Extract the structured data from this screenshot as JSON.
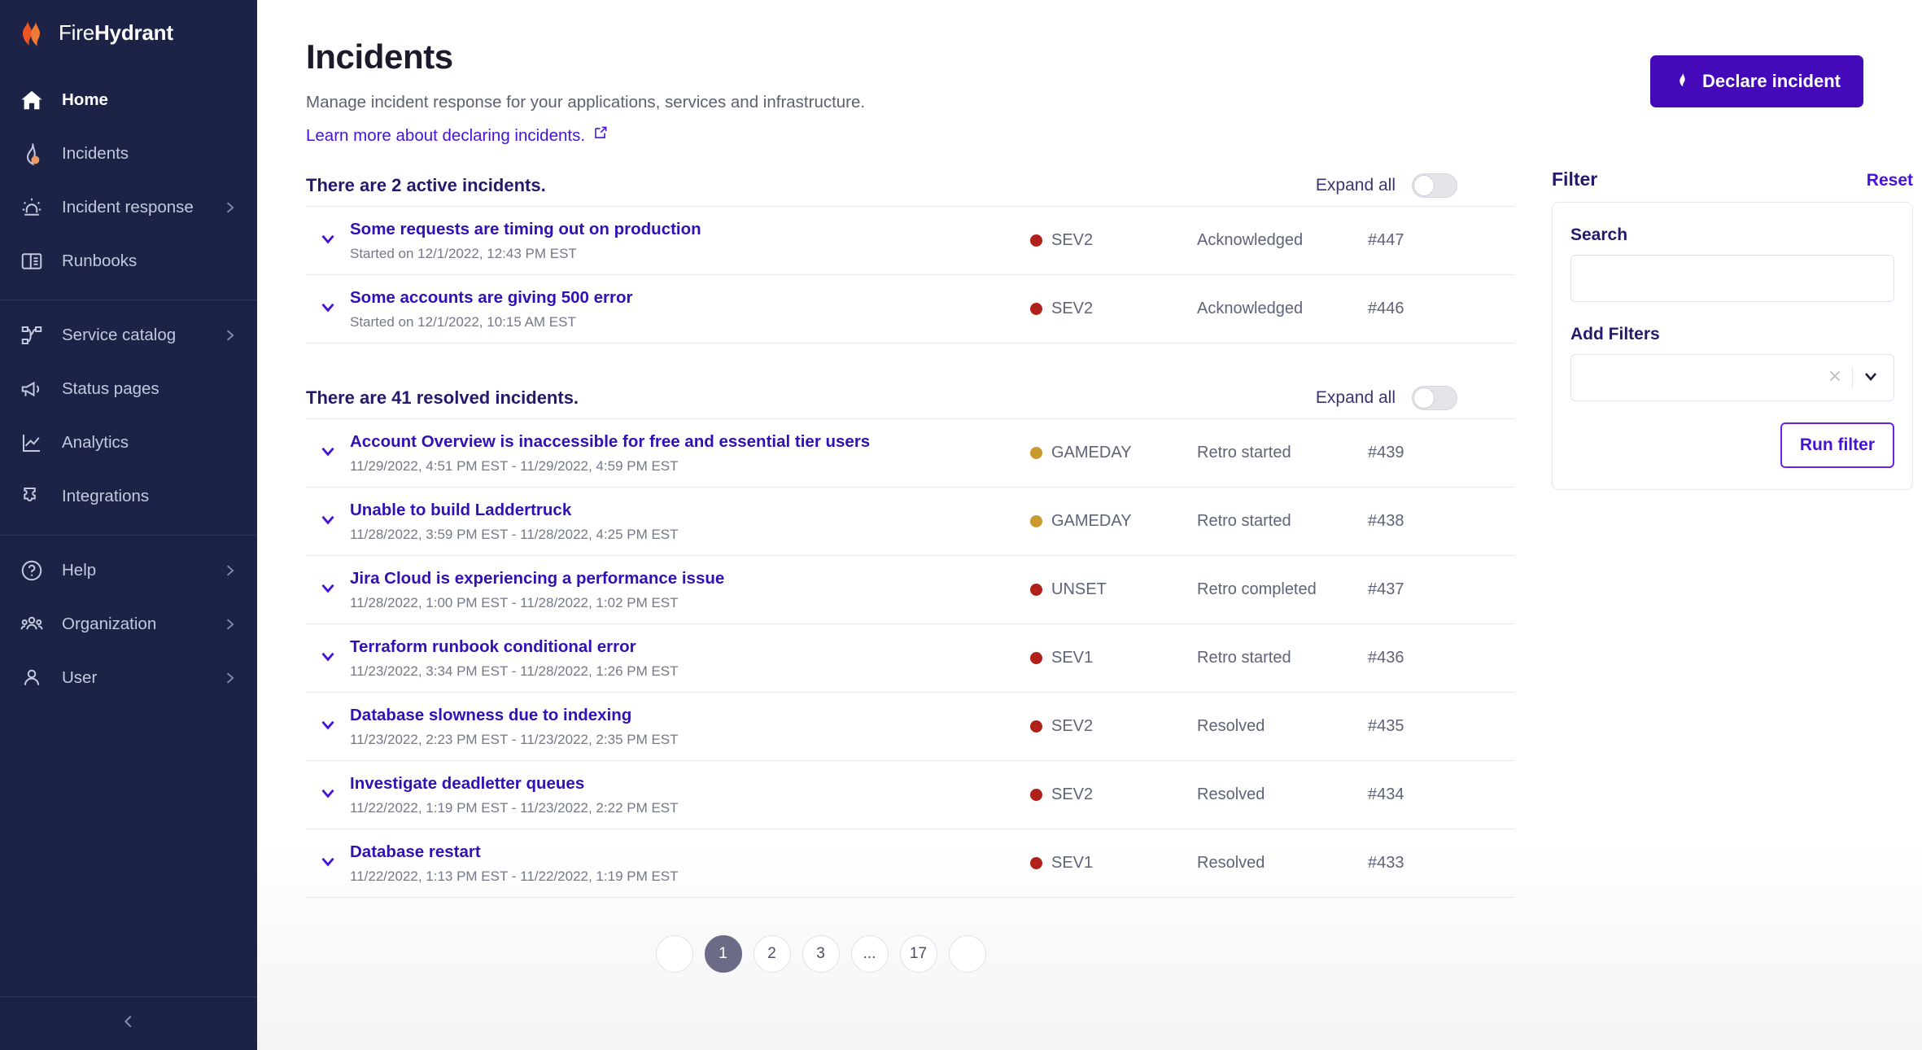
{
  "brand": {
    "name_light": "Fire",
    "name_bold": "Hydrant",
    "logo_icon": "firehydrant-flame-logo"
  },
  "sidebar": {
    "groups": [
      {
        "items": [
          {
            "label": "Home",
            "icon": "home-icon",
            "active": true,
            "caret": false
          },
          {
            "label": "Incidents",
            "icon": "flame-incidents-icon",
            "active": false,
            "caret": false
          },
          {
            "label": "Incident response",
            "icon": "siren-icon",
            "active": false,
            "caret": true
          },
          {
            "label": "Runbooks",
            "icon": "book-icon",
            "active": false,
            "caret": false
          }
        ]
      },
      {
        "items": [
          {
            "label": "Service catalog",
            "icon": "service-catalog-icon",
            "active": false,
            "caret": true
          },
          {
            "label": "Status pages",
            "icon": "megaphone-icon",
            "active": false,
            "caret": false
          },
          {
            "label": "Analytics",
            "icon": "chart-line-icon",
            "active": false,
            "caret": false
          },
          {
            "label": "Integrations",
            "icon": "puzzle-piece-icon",
            "active": false,
            "caret": false
          }
        ]
      },
      {
        "items": [
          {
            "label": "Help",
            "icon": "question-circle-icon",
            "active": false,
            "caret": true
          },
          {
            "label": "Organization",
            "icon": "people-group-icon",
            "active": false,
            "caret": true
          },
          {
            "label": "User",
            "icon": "user-icon",
            "active": false,
            "caret": true
          }
        ]
      }
    ],
    "collapse_icon": "chevron-left-icon"
  },
  "header": {
    "title": "Incidents",
    "subtitle": "Manage incident response for your applications, services and infrastructure.",
    "link_text": "Learn more about declaring incidents.",
    "link_icon": "external-link-icon",
    "declare_label": "Declare incident",
    "declare_icon": "flame-icon"
  },
  "active_section": {
    "title": "There are 2 active incidents.",
    "expand_label": "Expand all",
    "toggle_on": false,
    "rows": [
      {
        "title": "Some requests are timing out on production",
        "time": "Started on 12/1/2022, 12:43 PM EST",
        "severity": "SEV2",
        "sev_color": "#b0211a",
        "status": "Acknowledged",
        "number": "#447"
      },
      {
        "title": "Some accounts are giving 500 error",
        "time": "Started on 12/1/2022, 10:15 AM EST",
        "severity": "SEV2",
        "sev_color": "#b0211a",
        "status": "Acknowledged",
        "number": "#446"
      }
    ]
  },
  "resolved_section": {
    "title": "There are 41 resolved incidents.",
    "expand_label": "Expand all",
    "toggle_on": false,
    "rows": [
      {
        "title": "Account Overview is inaccessible for free and essential tier users",
        "time": "11/29/2022, 4:51 PM EST - 11/29/2022, 4:59 PM EST",
        "severity": "GAMEDAY",
        "sev_color": "#c99a2e",
        "status": "Retro started",
        "number": "#439"
      },
      {
        "title": "Unable to build Laddertruck",
        "time": "11/28/2022, 3:59 PM EST - 11/28/2022, 4:25 PM EST",
        "severity": "GAMEDAY",
        "sev_color": "#c99a2e",
        "status": "Retro started",
        "number": "#438"
      },
      {
        "title": "Jira Cloud is experiencing a performance issue",
        "time": "11/28/2022, 1:00 PM EST - 11/28/2022, 1:02 PM EST",
        "severity": "UNSET",
        "sev_color": "#b0211a",
        "status": "Retro completed",
        "number": "#437"
      },
      {
        "title": "Terraform runbook conditional error",
        "time": "11/23/2022, 3:34 PM EST - 11/28/2022, 1:26 PM EST",
        "severity": "SEV1",
        "sev_color": "#b0211a",
        "status": "Retro started",
        "number": "#436"
      },
      {
        "title": "Database slowness due to indexing",
        "time": "11/23/2022, 2:23 PM EST - 11/23/2022, 2:35 PM EST",
        "severity": "SEV2",
        "sev_color": "#b0211a",
        "status": "Resolved",
        "number": "#435"
      },
      {
        "title": "Investigate deadletter queues",
        "time": "11/22/2022, 1:19 PM EST - 11/23/2022, 2:22 PM EST",
        "severity": "SEV2",
        "sev_color": "#b0211a",
        "status": "Resolved",
        "number": "#434"
      },
      {
        "title": "Database restart",
        "time": "11/22/2022, 1:13 PM EST - 11/22/2022, 1:19 PM EST",
        "severity": "SEV1",
        "sev_color": "#b0211a",
        "status": "Resolved",
        "number": "#433"
      }
    ]
  },
  "pagination": {
    "prev_icon": "chevron-left-icon",
    "next_icon": "chevron-right-icon",
    "pages": [
      "1",
      "2",
      "3",
      "...",
      "17"
    ],
    "current": "1"
  },
  "filter": {
    "title": "Filter",
    "reset_label": "Reset",
    "search_label": "Search",
    "search_value": "",
    "search_placeholder": "",
    "add_filters_label": "Add Filters",
    "add_filters_value": "",
    "clear_icon": "close-x-icon",
    "chevron_icon": "chevron-down-icon",
    "run_label": "Run filter"
  },
  "colors": {
    "sidebar_bg": "#1c2347",
    "brand_purple": "#4409b9",
    "link_purple": "#4612d8",
    "title_navy": "#241a6b",
    "sev_red": "#b0211a",
    "gameday_amber": "#c99a2e"
  }
}
